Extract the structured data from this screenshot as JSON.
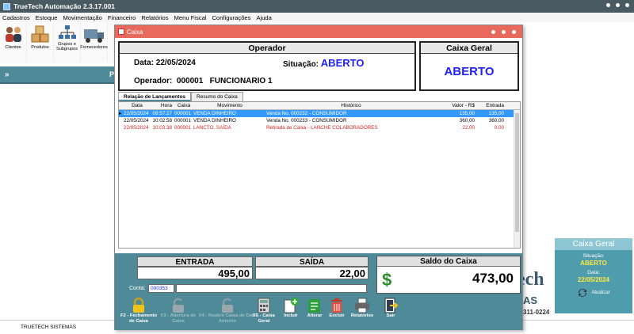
{
  "app": {
    "title": "TrueTech Automação 2.3.17.001",
    "menu": [
      "Cadastros",
      "Estoque",
      "Movimentação",
      "Financeiro",
      "Relatórios",
      "Menu Fiscal",
      "Configurações",
      "Ajuda"
    ],
    "toolbar": [
      {
        "label": "Clientes",
        "icon": "clients-icon"
      },
      {
        "label": "Produtos",
        "icon": "boxes-icon"
      },
      {
        "label": "Grupos e Subgrupos",
        "icon": "hierarchy-icon"
      },
      {
        "label": "Fornecedores",
        "icon": "truck-icon"
      }
    ],
    "left_bar_symbol": "»",
    "left_bar_text": "P",
    "brand": {
      "tech": "ech",
      "as": "AS",
      "phone": "311-0224"
    },
    "status_bar": "TRUETECH SISTEMAS"
  },
  "cash_widget": {
    "title": "Caixa Geral",
    "situacao_label": "Situação:",
    "situacao_value": "ABERTO",
    "data_label": "Data:",
    "data_value": "22/05/2024",
    "update_label": "Atualizar"
  },
  "dialog": {
    "title": "Caixa",
    "operator": {
      "heading": "Operador",
      "date_label": "Data:",
      "date_value": "22/05/2024",
      "situacao_label": "Situação:",
      "situacao_value": "ABERTO",
      "operador_label": "Operador:",
      "operador_code": "000001",
      "operador_name": "FUNCIONARIO 1"
    },
    "caixa_geral": {
      "heading": "Caixa Geral",
      "value": "ABERTO"
    },
    "tabs": [
      "Relação de Lançamentos",
      "Resumo do Caixa"
    ],
    "grid": {
      "columns": [
        "Data",
        "Hora",
        "Caixa",
        "Movimento",
        "Histórico",
        "Valor - R$",
        "Entrada"
      ],
      "rows": [
        {
          "data": "22/05/2024",
          "hora": "09:57:27",
          "caixa": "000001",
          "movimento": "VENDA DINHEIRO",
          "historico": "Venda No. 000232 - CONSUMIDOR",
          "valor": "135,00",
          "entrada": "135,00"
        },
        {
          "data": "22/05/2024",
          "hora": "10:02:58",
          "caixa": "000001",
          "movimento": "VENDA DINHEIRO",
          "historico": "Venda No. 000233 - CONSUMIDOR",
          "valor": "360,00",
          "entrada": "360,00"
        },
        {
          "data": "22/05/2024",
          "hora": "10:03:38",
          "caixa": "000001",
          "movimento": "LANCTO. SAÍDA",
          "historico": "Retirada de Caixa - LANCHE COLABORADORES",
          "valor": "22,00",
          "entrada": "0,00"
        }
      ]
    },
    "totals": {
      "entrada_label": "ENTRADA",
      "entrada_value": "495,00",
      "saida_label": "SAÍDA",
      "saida_value": "22,00",
      "saldo_label": "Saldo do Caixa",
      "saldo_value": "473,00",
      "currency_symbol": "$"
    },
    "conta_label": "Conta:",
    "conta_value": "000353",
    "actions": [
      {
        "label": "F2 - Fechamento de Caixa",
        "icon": "lock-icon",
        "enabled": true
      },
      {
        "label": "F3 - Abertura de Caixa",
        "icon": "unlock-icon",
        "enabled": false
      },
      {
        "label": "F4 - Reabrir Caixa de Data Anterior",
        "icon": "unlock-icon",
        "enabled": false
      },
      {
        "label": "F5 - Caixa Geral",
        "icon": "calculator-icon",
        "enabled": true
      },
      {
        "label": "Incluir",
        "icon": "new-document-icon",
        "enabled": true
      },
      {
        "label": "Alterar",
        "icon": "edit-icon",
        "enabled": true
      },
      {
        "label": "Excluir",
        "icon": "trash-icon",
        "enabled": true
      },
      {
        "label": "Relatórios",
        "icon": "printer-icon",
        "enabled": true
      },
      {
        "label": "Sair",
        "icon": "exit-icon",
        "enabled": true
      }
    ],
    "colors": {
      "title_bar": "#e86a5c",
      "panel": "#4f8a99",
      "status_blue": "#1e1eff",
      "red_row": "#e02020",
      "selected_row": "#3399ff"
    }
  }
}
